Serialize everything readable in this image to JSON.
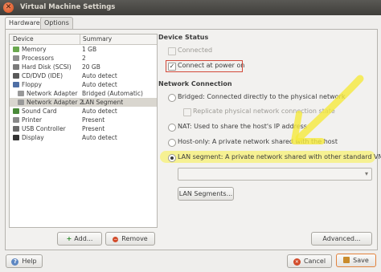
{
  "window": {
    "title": "Virtual Machine Settings",
    "close_glyph": "✕"
  },
  "tabs": [
    {
      "label": "Hardware",
      "active": true
    },
    {
      "label": "Options",
      "active": false
    }
  ],
  "device_list": {
    "headers": {
      "device": "Device",
      "summary": "Summary"
    },
    "rows": [
      {
        "device": "Memory",
        "summary": "1 GB",
        "icon": "memory-icon",
        "icon_color": "#6aa84f"
      },
      {
        "device": "Processors",
        "summary": "2",
        "icon": "processor-icon",
        "icon_color": "#8e8e8e"
      },
      {
        "device": "Hard Disk (SCSI)",
        "summary": "20 GB",
        "icon": "hard-disk-icon",
        "icon_color": "#7a7a7a"
      },
      {
        "device": "CD/DVD (IDE)",
        "summary": "Auto detect",
        "icon": "cd-dvd-icon",
        "icon_color": "#5a5a5a"
      },
      {
        "device": "Floppy",
        "summary": "Auto detect",
        "icon": "floppy-icon",
        "icon_color": "#4f6fa5"
      },
      {
        "device": "Network Adapter",
        "summary": "Bridged (Automatic)",
        "icon": "network-icon",
        "icon_color": "#999999"
      },
      {
        "device": "Network Adapter 2",
        "summary": "LAN Segment",
        "icon": "network-icon",
        "icon_color": "#999999",
        "selected": true
      },
      {
        "device": "Sound Card",
        "summary": "Auto detect",
        "icon": "sound-card-icon",
        "icon_color": "#4a8a3a"
      },
      {
        "device": "Printer",
        "summary": "Present",
        "icon": "printer-icon",
        "icon_color": "#8a8a8a"
      },
      {
        "device": "USB Controller",
        "summary": "Present",
        "icon": "usb-icon",
        "icon_color": "#6b6b6b"
      },
      {
        "device": "Display",
        "summary": "Auto detect",
        "icon": "display-icon",
        "icon_color": "#333333"
      }
    ],
    "add_label": "Add...",
    "remove_label": "Remove"
  },
  "device_status": {
    "title": "Device Status",
    "connected_label": "Connected",
    "connected_checked": false,
    "connect_at_power_on_label": "Connect at power on",
    "connect_at_power_on_checked": true
  },
  "network_connection": {
    "title": "Network Connection",
    "bridged_label": "Bridged: Connected directly to the physical network",
    "replicate_label": "Replicate physical network connection state",
    "nat_label": "NAT: Used to share the host's IP address",
    "host_only_label": "Host-only: A private network shared with the host",
    "lan_segment_label": "LAN segment: A private network shared with other standard VMs",
    "selected": "lan_segment",
    "lan_segment_value": "",
    "lan_segments_button": "LAN Segments..."
  },
  "advanced_button": "Advanced...",
  "footer": {
    "help_label": "Help",
    "cancel_label": "Cancel",
    "save_label": "Save"
  },
  "colors": {
    "annotation_highlight": "#f7ec3a",
    "accent_orange": "#e3823c",
    "selected_row": "#d9d6cf"
  }
}
